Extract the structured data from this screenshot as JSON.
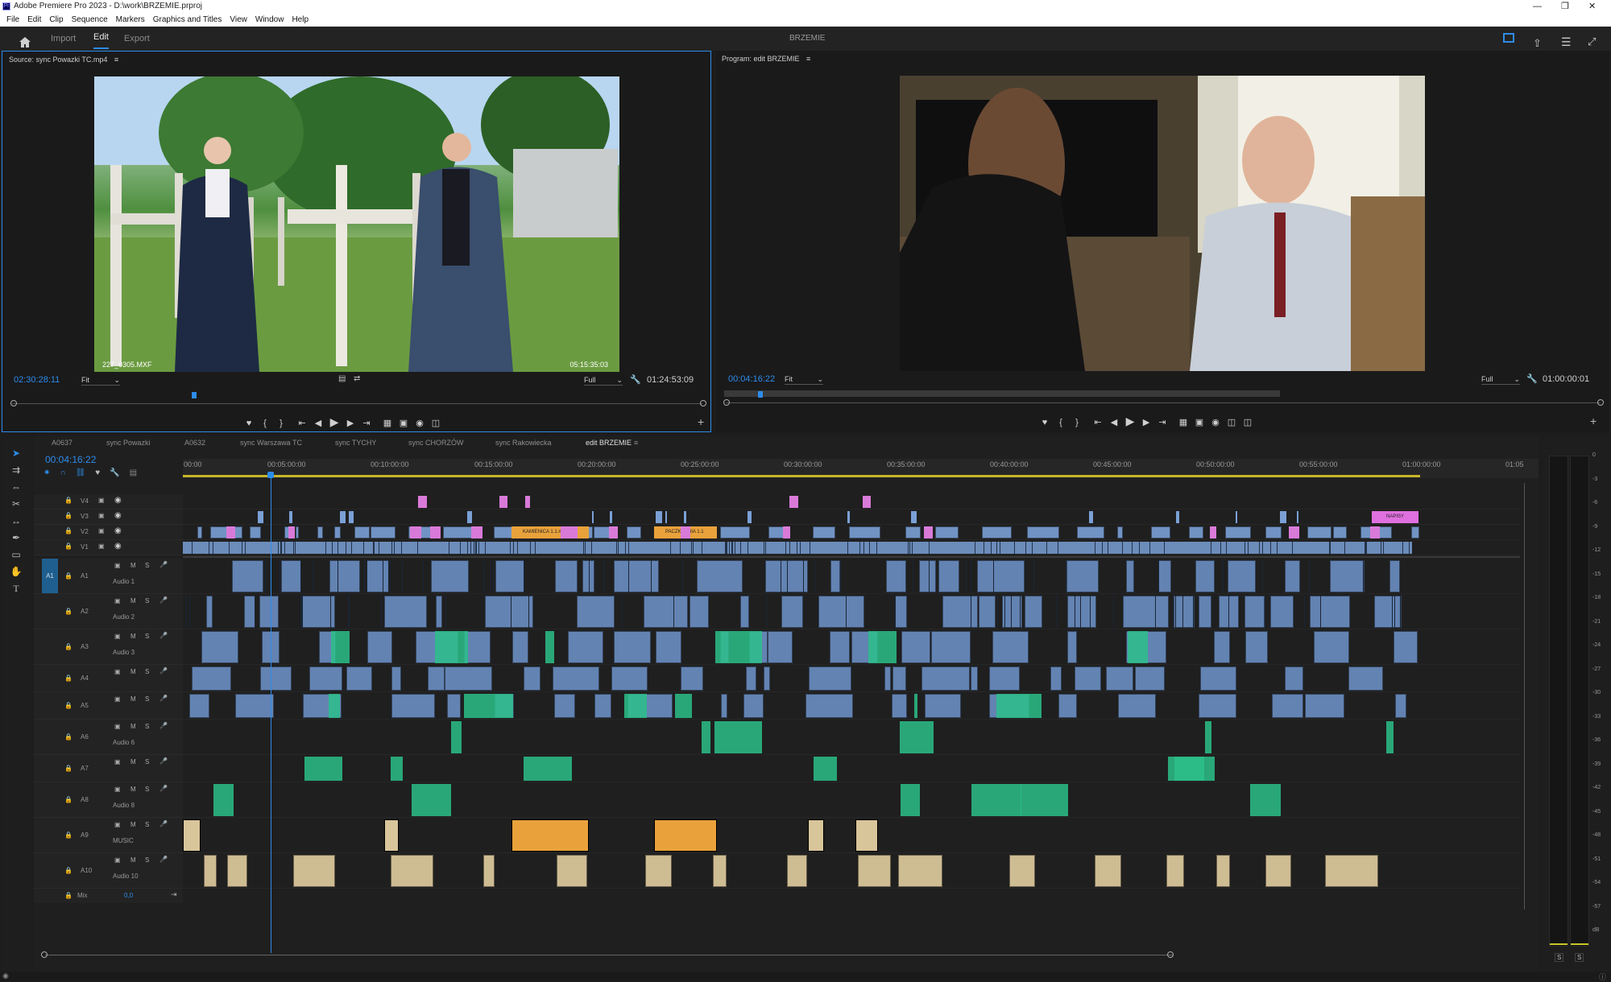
{
  "app": {
    "title": "Adobe Premiere Pro 2023 - D:\\work\\BRZEMIE.prproj"
  },
  "menu": [
    "File",
    "Edit",
    "Clip",
    "Sequence",
    "Markers",
    "Graphics and Titles",
    "View",
    "Window",
    "Help"
  ],
  "workspace": {
    "tabs": [
      "Import",
      "Edit",
      "Export"
    ],
    "active": "Edit",
    "project_name": "BRZEMIE"
  },
  "source": {
    "title": "Source: sync Powazki TC.mp4",
    "overlay_left": "227_0305.MXF",
    "overlay_right": "05:15:35:03",
    "timecode": "02:30:28:11",
    "fit": "Fit",
    "quality": "Full",
    "duration": "01:24:53:09",
    "playhead_fraction": 0.26
  },
  "program": {
    "title": "Program: edit BRZEMIE",
    "timecode": "00:04:16:22",
    "fit": "Fit",
    "quality": "Full",
    "duration": "01:00:00:01",
    "playhead_fraction": 0.05
  },
  "sequence_tabs": [
    "A0637",
    "sync Powazki",
    "A0632",
    "sync Warszawa TC",
    "sync TYCHY",
    "sync CHORZÓW",
    "sync Rakowiecka",
    "edit BRZEMIE"
  ],
  "active_sequence": "edit BRZEMIE",
  "timeline": {
    "timecode": "00:04:16:22",
    "playhead_fraction": 0.071,
    "ruler": [
      "00:00",
      "00:05:00:00",
      "00:10:00:00",
      "00:15:00:00",
      "00:20:00:00",
      "00:25:00:00",
      "00:30:00:00",
      "00:35:00:00",
      "00:40:00:00",
      "00:45:00:00",
      "00:50:00:00",
      "00:55:00:00",
      "01:00:00:00",
      "01:05"
    ],
    "video_tracks": [
      "V4",
      "V3",
      "V2",
      "V1"
    ],
    "audio_tracks": [
      {
        "id": "A1",
        "name": "Audio 1"
      },
      {
        "id": "A2",
        "name": "Audio 2"
      },
      {
        "id": "A3",
        "name": "Audio 3"
      },
      {
        "id": "A4",
        "name": ""
      },
      {
        "id": "A5",
        "name": ""
      },
      {
        "id": "A6",
        "name": "Audio 6"
      },
      {
        "id": "A7",
        "name": ""
      },
      {
        "id": "A8",
        "name": "Audio 8"
      },
      {
        "id": "A9",
        "name": "MUSIC"
      },
      {
        "id": "A10",
        "name": "Audio 10"
      }
    ],
    "mix": {
      "label": "Mix",
      "value": "0,0"
    },
    "track_buttons": {
      "mute": "M",
      "solo": "S"
    },
    "clip_labels": {
      "kamienica": "KAMIENICA 1.1.mp4 [V]",
      "paczkarnia": "PACZKARNIA 1.1",
      "napisy": "NAPISY"
    }
  },
  "meter": {
    "scale": [
      "0",
      "-3",
      "-6",
      "-9",
      "-12",
      "-15",
      "-18",
      "-21",
      "-24",
      "-27",
      "-30",
      "-33",
      "-36",
      "-39",
      "-42",
      "-45",
      "-48",
      "-51",
      "-54",
      "-57",
      "dB"
    ],
    "solo": [
      "S",
      "S"
    ]
  },
  "colors": {
    "accent": "#2d8ceb",
    "video_clip": "#7aa0d6",
    "audio_blue": "#6f95cc",
    "audio_green": "#2bbf8a",
    "music": "#e9a23b",
    "audio_tan": "#d8c59a",
    "graphic_pink": "#d97ad9",
    "title_pink": "#e070e0"
  }
}
